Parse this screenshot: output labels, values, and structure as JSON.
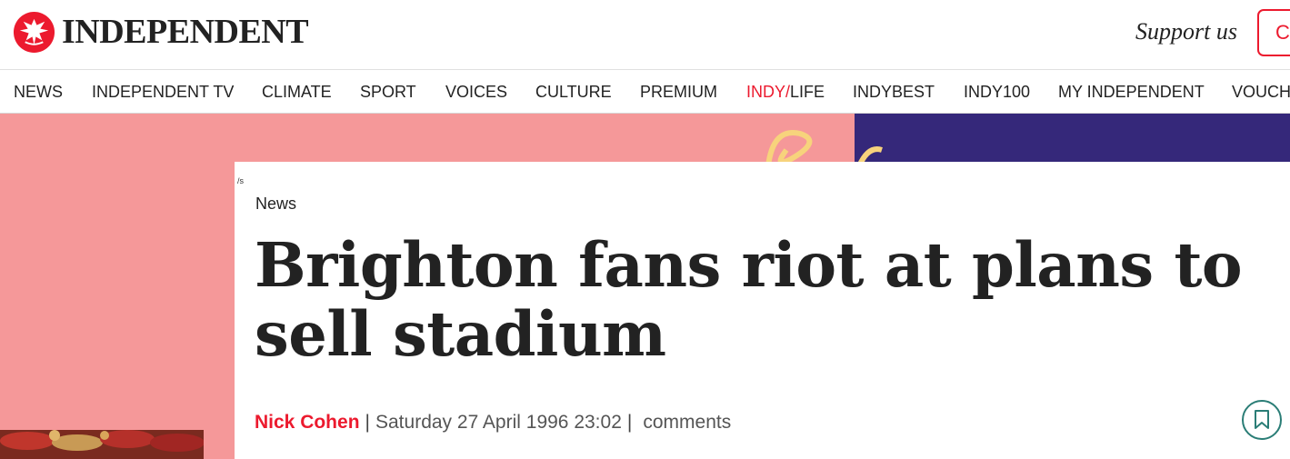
{
  "masthead": {
    "brand": "INDEPENDENT",
    "support_label": "Support us",
    "cta_label": "C",
    "accent_color": "#ec1a2e"
  },
  "nav": {
    "items": [
      {
        "label": "NEWS"
      },
      {
        "label": "INDEPENDENT TV"
      },
      {
        "label": "CLIMATE"
      },
      {
        "label": "SPORT"
      },
      {
        "label": "VOICES"
      },
      {
        "label": "CULTURE"
      },
      {
        "label": "PREMIUM"
      },
      {
        "label_red": "INDY/",
        "label": "LIFE"
      },
      {
        "label": "INDYBEST"
      },
      {
        "label": "INDY100"
      },
      {
        "label": "MY INDEPENDENT"
      },
      {
        "label": "VOUCH"
      }
    ]
  },
  "hero": {
    "left_color": "#f59899",
    "right_color": "#35287a"
  },
  "article": {
    "broken_image_alt": "/s",
    "section": "News",
    "headline": "Brighton fans riot at plans to sell stadium",
    "author": "Nick Cohen",
    "separator": "|",
    "date": "Saturday 27 April 1996 23:02",
    "comments_label": "comments",
    "bookmark_icon": "bookmark-icon"
  }
}
